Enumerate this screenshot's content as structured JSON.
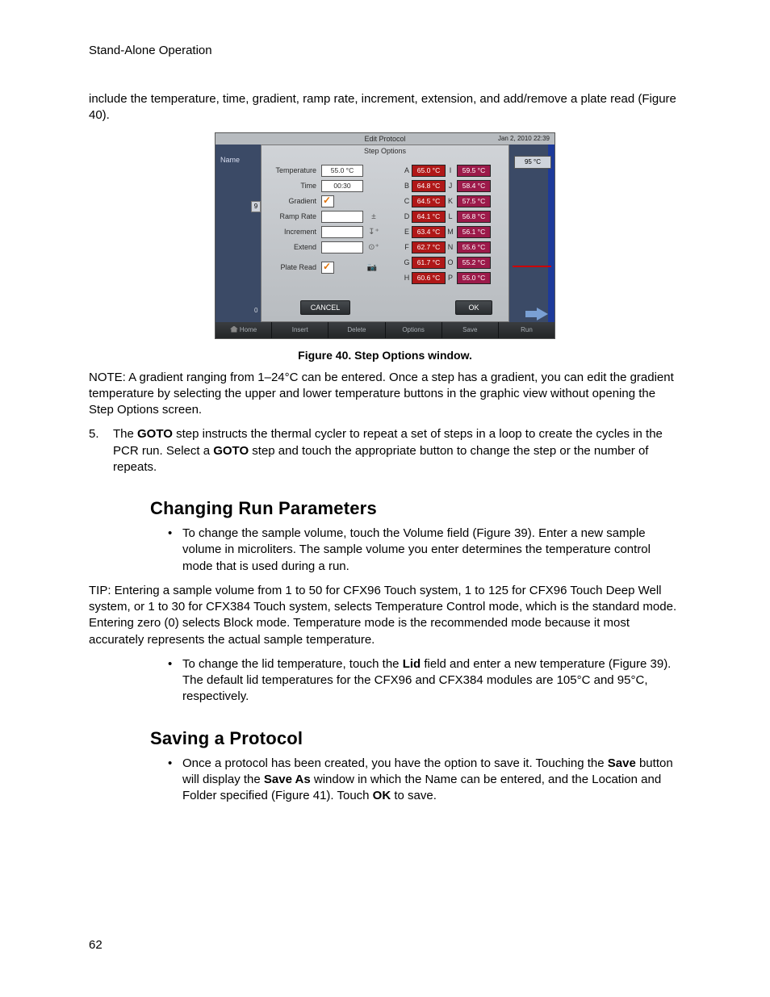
{
  "running_head": "Stand-Alone Operation",
  "page_number": "62",
  "intro": "include the temperature, time, gradient, ramp rate, increment, extension, and add/remove a plate read (Figure 40).",
  "figure_caption": "Figure 40. Step Options window.",
  "note": "NOTE: A gradient ranging from 1–24°C can be entered. Once a step has a gradient, you can edit the gradient temperature by selecting the upper and lower temperature buttons in the graphic view without opening the Step Options screen.",
  "list5_num": "5.",
  "list5_a": "The ",
  "list5_b": "GOTO",
  "list5_c": " step instructs the thermal cycler to repeat a set of steps in a loop to create the cycles in the PCR run. Select a ",
  "list5_d": "GOTO",
  "list5_e": " step and touch the appropriate button to change the step or the number of repeats.",
  "h2a": "Changing Run Parameters",
  "crp_b1": "To change the sample volume, touch the Volume field (Figure 39). Enter a new sample volume in microliters. The sample volume you enter determines the temperature control mode that is used during a run.",
  "crp_tip": "TIP: Entering a sample volume from 1 to 50 for CFX96 Touch system, 1 to 125 for CFX96 Touch Deep Well system, or 1 to 30 for CFX384 Touch system, selects Temperature Control mode, which is the standard mode. Entering zero (0) selects Block mode. Temperature mode is the recommended mode because it most accurately represents the actual sample temperature.",
  "crp_b2_a": "To change the lid temperature, touch the ",
  "crp_b2_b": "Lid",
  "crp_b2_c": " field and enter a new temperature (Figure 39). The default lid temperatures for the CFX96 and CFX384 modules are 105°C and 95°C, respectively.",
  "h2b": "Saving a Protocol",
  "sp_a": "Once a protocol has been created, you have the option to save it. Touching the ",
  "sp_b": "Save",
  "sp_c": " button will display the ",
  "sp_d": "Save As",
  "sp_e": " window in which the Name can be entered, and the Location and Folder specified (Figure 41). Touch ",
  "sp_f": "OK",
  "sp_g": " to save.",
  "fig": {
    "title": "Edit Protocol",
    "timestamp": "Jan 2, 2010 22:39",
    "subtitle": "Step Options",
    "name_label": "Name",
    "axis9": "9",
    "axis0": "0",
    "right_temp": "95 °C",
    "cancel": "CANCEL",
    "ok": "OK",
    "bottom": [
      "Home",
      "Insert",
      "Delete",
      "Options",
      "Save",
      "Run"
    ],
    "opts": {
      "temperature_lbl": "Temperature",
      "temperature_val": "55.0 °C",
      "time_lbl": "Time",
      "time_val": "00:30",
      "gradient_lbl": "Gradient",
      "ramp_lbl": "Ramp Rate",
      "increment_lbl": "Increment",
      "extend_lbl": "Extend",
      "plate_lbl": "Plate Read"
    },
    "gradient": [
      {
        "l": "A",
        "v1": "65.0 °C",
        "r": "I",
        "v2": "59.5 °C"
      },
      {
        "l": "B",
        "v1": "64.8 °C",
        "r": "J",
        "v2": "58.4 °C"
      },
      {
        "l": "C",
        "v1": "64.5 °C",
        "r": "K",
        "v2": "57.5 °C"
      },
      {
        "l": "D",
        "v1": "64.1 °C",
        "r": "L",
        "v2": "56.8 °C"
      },
      {
        "l": "E",
        "v1": "63.4 °C",
        "r": "M",
        "v2": "56.1 °C"
      },
      {
        "l": "F",
        "v1": "62.7 °C",
        "r": "N",
        "v2": "55.6 °C"
      },
      {
        "l": "G",
        "v1": "61.7 °C",
        "r": "O",
        "v2": "55.2 °C"
      },
      {
        "l": "H",
        "v1": "60.6 °C",
        "r": "P",
        "v2": "55.0 °C"
      }
    ]
  }
}
